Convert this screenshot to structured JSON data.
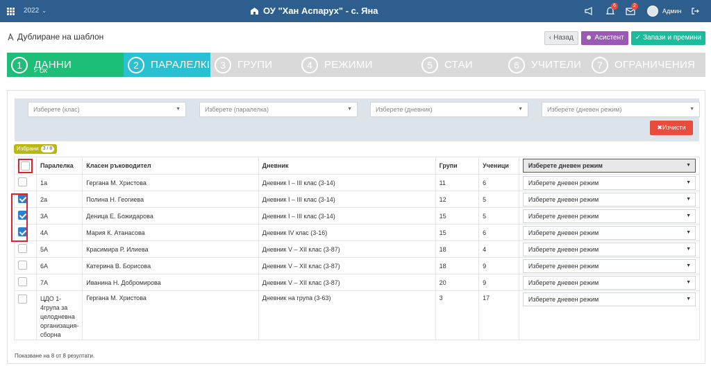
{
  "topbar": {
    "year": "2022",
    "school": "ОУ \"Хан Аспарух\" - с. Яна",
    "notif_count": "6",
    "msg_count": "2",
    "user": "Админ"
  },
  "page": {
    "title": "Дублиране на шаблон"
  },
  "buttons": {
    "back": "Назад",
    "assistant": "Асистент",
    "save": "Запази и премини"
  },
  "steps": [
    {
      "num": "1",
      "label": "ДАННИ",
      "status": "OK"
    },
    {
      "num": "2",
      "label": "ПАРАЛЕЛКИ"
    },
    {
      "num": "3",
      "label": "ГРУПИ"
    },
    {
      "num": "4",
      "label": "РЕЖИМИ"
    },
    {
      "num": "5",
      "label": "СТАИ"
    },
    {
      "num": "6",
      "label": "УЧИТЕЛИ"
    },
    {
      "num": "7",
      "label": "ОГРАНИЧЕНИЯ"
    }
  ],
  "filters": {
    "class": "Изберете (клас)",
    "paralelka": "Изберете (паралелка)",
    "dnevnik": "Изберете (дневник)",
    "rezhim": "Изберете (дневен режим)",
    "clear": "Изчисти"
  },
  "selected": {
    "label": "Избрани",
    "count": "3 / 8"
  },
  "table": {
    "headers": [
      "Паралелка",
      "Класен ръководител",
      "Дневник",
      "Групи",
      "Ученици"
    ],
    "header_select": "Изберете дневен режим",
    "row_select": "Изберете дневен режим",
    "rows": [
      {
        "par": "1а",
        "teacher": "Гергана М. Христова",
        "diary": "Дневник I – III клас (3-14)",
        "groups": "11",
        "students": "6",
        "checked": false
      },
      {
        "par": "2а",
        "teacher": "Полина Н. Геогиева",
        "diary": "Дневник I – III клас (3-14)",
        "groups": "12",
        "students": "5",
        "checked": true
      },
      {
        "par": "3А",
        "teacher": "Деница Е. Божидарова",
        "diary": "Дневник I – III клас (3-14)",
        "groups": "15",
        "students": "5",
        "checked": true
      },
      {
        "par": "4А",
        "teacher": "Мария К. Атанасова",
        "diary": "Дневник IV клас (3-16)",
        "groups": "15",
        "students": "6",
        "checked": true
      },
      {
        "par": "5А",
        "teacher": "Красимира Р. Илиева",
        "diary": "Дневник V – XII клас (3-87)",
        "groups": "18",
        "students": "4",
        "checked": false
      },
      {
        "par": "6А",
        "teacher": "Катерина В. Борисова",
        "diary": "Дневник V – XII клас (3-87)",
        "groups": "18",
        "students": "9",
        "checked": false
      },
      {
        "par": "7А",
        "teacher": "Иванина Н. Добромирова",
        "diary": "Дневник V – XII клас (3-87)",
        "groups": "20",
        "students": "9",
        "checked": false
      },
      {
        "par": "ЦДО 1-4група за целодневна организация-сборна",
        "teacher": "Гергана М. Христова",
        "diary": "Дневник на група (3-63)",
        "groups": "3",
        "students": "17",
        "checked": false
      }
    ]
  },
  "footer": "Показване на 8 от 8 резултати."
}
